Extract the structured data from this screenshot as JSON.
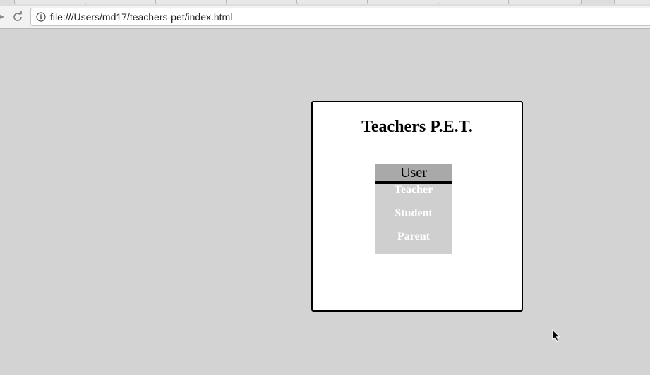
{
  "browser": {
    "url": "file:///Users/md17/teachers-pet/index.html",
    "icons": {
      "forward": "forward-arrow-icon",
      "reload": "reload-icon",
      "info": "info-icon"
    }
  },
  "page": {
    "title": "Teachers P.E.T.",
    "dropdown": {
      "label": "User",
      "options": [
        "Teacher",
        "Student",
        "Parent"
      ]
    }
  },
  "colors": {
    "page_background": "#d3d3d3",
    "card_background": "#ffffff",
    "dropdown_header": "#a9a9a9",
    "dropdown_list": "#cfcfcf"
  }
}
